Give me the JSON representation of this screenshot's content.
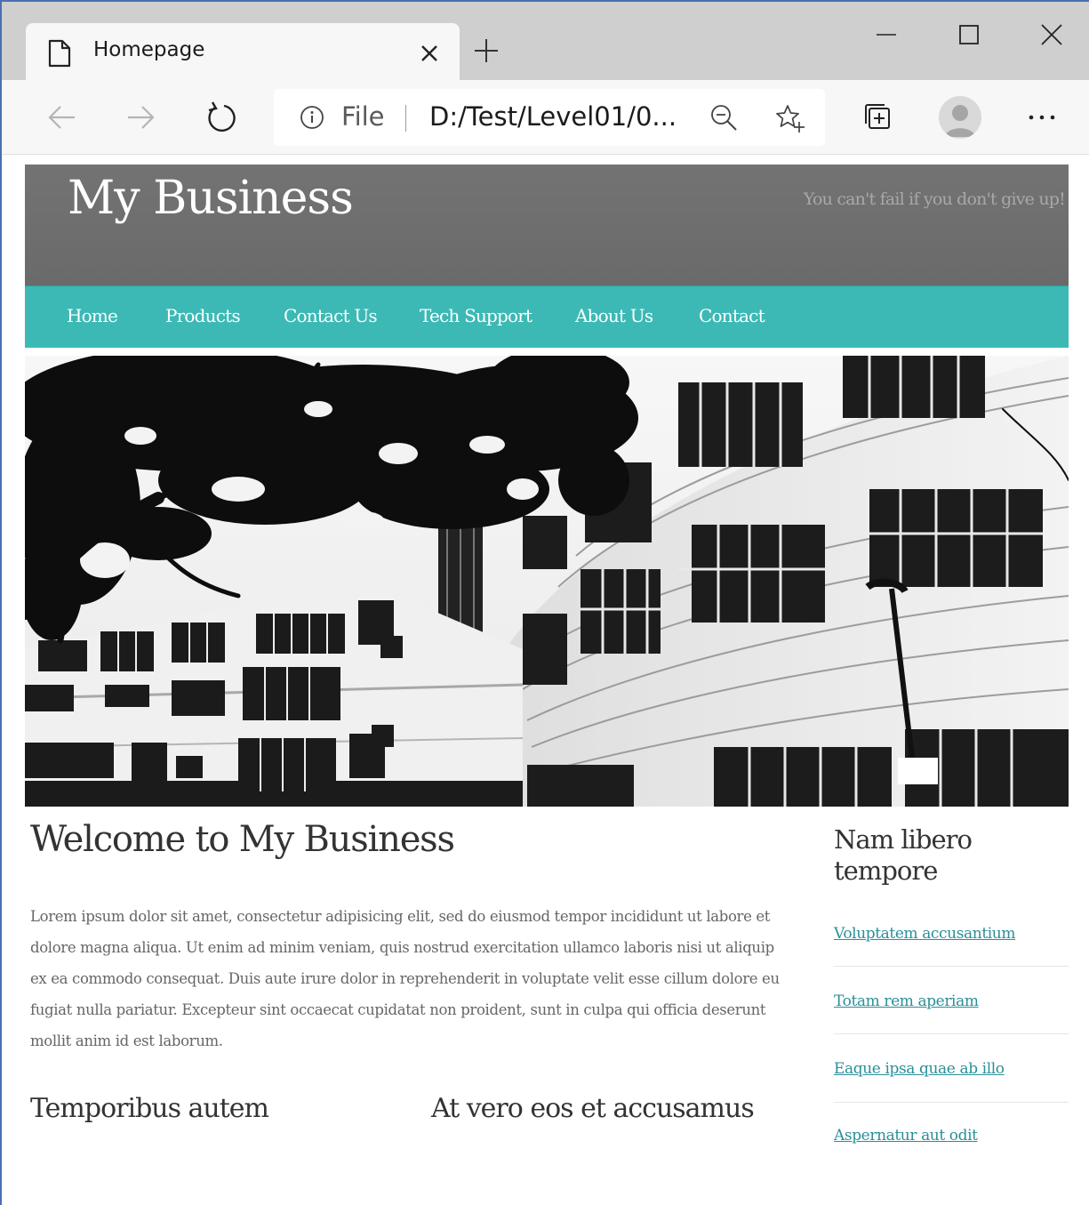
{
  "browser": {
    "tab_title": "Homepage",
    "omnibox": {
      "scheme_label": "File",
      "url": "D:/Test/Level01/0..."
    }
  },
  "site": {
    "title": "My Business",
    "slogan": "You can't fail if you don't give up!",
    "nav": [
      "Home",
      "Products",
      "Contact Us",
      "Tech Support",
      "About Us",
      "Contact"
    ],
    "accent_color": "#3cb9b5",
    "header_color": "#6e6e6e"
  },
  "main": {
    "heading": "Welcome to My Business",
    "intro": "Lorem ipsum dolor sit amet, consectetur adipisicing elit, sed do eiusmod tempor incididunt ut labore et dolore magna aliqua. Ut enim ad minim veniam, quis nostrud exercitation ullamco laboris nisi ut aliquip ex ea commodo consequat. Duis aute irure dolor in reprehenderit in voluptate velit esse cillum dolore eu fugiat nulla pariatur. Excepteur sint occaecat cupidatat non proident, sunt in culpa qui officia deserunt mollit anim id est laborum.",
    "subheadings": [
      "Temporibus autem",
      "At vero eos et accusamus"
    ]
  },
  "sidebar": {
    "heading": "Nam libero tempore",
    "links": [
      "Voluptatem accusantium",
      "Totam rem aperiam",
      "Eaque ipsa quae ab illo",
      "Aspernatur aut odit"
    ],
    "link_color": "#2a8f99"
  },
  "icons": {
    "tab": "document-icon",
    "close": "close-icon",
    "new_tab": "plus-icon",
    "back": "arrow-left-icon",
    "forward": "arrow-right-icon",
    "reload": "refresh-icon",
    "info": "info-icon",
    "zoom": "zoom-out-icon",
    "favorite": "star-plus-icon",
    "collections": "collections-icon",
    "profile": "avatar-icon",
    "more": "ellipsis-icon"
  }
}
